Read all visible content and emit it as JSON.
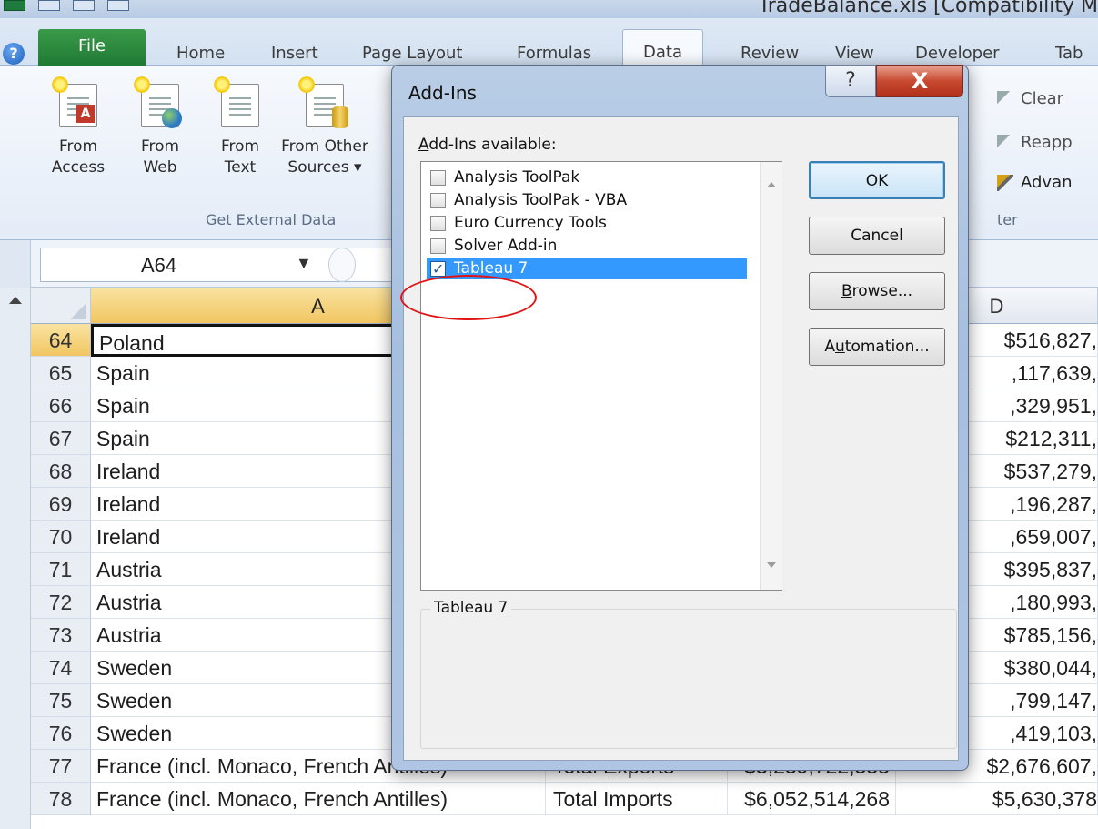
{
  "window": {
    "title": "TradeBalance.xls [Compatibility M"
  },
  "tabs": [
    {
      "label": "File"
    },
    {
      "label": "Home"
    },
    {
      "label": "Insert"
    },
    {
      "label": "Page Layout"
    },
    {
      "label": "Formulas"
    },
    {
      "label": "Data"
    },
    {
      "label": "Review"
    },
    {
      "label": "View"
    },
    {
      "label": "Developer"
    },
    {
      "label": "Tab"
    }
  ],
  "ribbon": {
    "from_access": "From\nAccess",
    "from_web": "From\nWeb",
    "from_text": "From\nText",
    "from_other": "From Other\nSources ▾",
    "group_get_external": "Get External Data",
    "clear": "Clear",
    "reapply": "Reapp",
    "advanced": "Advan",
    "group_filter_tail": "ter"
  },
  "formula_bar": {
    "name_box": "A64"
  },
  "sheet": {
    "columns": {
      "A": "A",
      "D": "D"
    },
    "rows": [
      {
        "n": "64",
        "a": "Poland",
        "b": "",
        "c": "",
        "d": "$516,827,"
      },
      {
        "n": "65",
        "a": "Spain",
        "b": "",
        "c": "",
        "d": ",117,639,"
      },
      {
        "n": "66",
        "a": "Spain",
        "b": "",
        "c": "",
        "d": ",329,951,"
      },
      {
        "n": "67",
        "a": "Spain",
        "b": "",
        "c": "",
        "d": "$212,311,"
      },
      {
        "n": "68",
        "a": "Ireland",
        "b": "",
        "c": "",
        "d": "$537,279,"
      },
      {
        "n": "69",
        "a": "Ireland",
        "b": "",
        "c": "",
        "d": ",196,287,"
      },
      {
        "n": "70",
        "a": "Ireland",
        "b": "",
        "c": "",
        "d": ",659,007,"
      },
      {
        "n": "71",
        "a": "Austria",
        "b": "",
        "c": "",
        "d": "$395,837,"
      },
      {
        "n": "72",
        "a": "Austria",
        "b": "",
        "c": "",
        "d": ",180,993,"
      },
      {
        "n": "73",
        "a": "Austria",
        "b": "",
        "c": "",
        "d": "$785,156,"
      },
      {
        "n": "74",
        "a": "Sweden",
        "b": "",
        "c": "",
        "d": "$380,044,"
      },
      {
        "n": "75",
        "a": "Sweden",
        "b": "",
        "c": "",
        "d": ",799,147,"
      },
      {
        "n": "76",
        "a": "Sweden",
        "b": "",
        "c": "",
        "d": ",419,103,"
      },
      {
        "n": "77",
        "a": "France (incl. Monaco, French Antilles)",
        "b": "Total Exports",
        "c": "$3,239,722,555",
        "d": "$2,676,607,"
      },
      {
        "n": "78",
        "a": "France (incl. Monaco, French Antilles)",
        "b": "Total Imports",
        "c": "$6,052,514,268",
        "d": "$5,630,378"
      }
    ]
  },
  "dialog": {
    "title": "Add-Ins",
    "help": "?",
    "close": "X",
    "available_label_u": "A",
    "available_label_rest": "dd-Ins available:",
    "items": [
      {
        "label": "Analysis ToolPak",
        "checked": false
      },
      {
        "label": "Analysis ToolPak - VBA",
        "checked": false
      },
      {
        "label": "Euro Currency Tools",
        "checked": false
      },
      {
        "label": "Solver Add-in",
        "checked": false
      },
      {
        "label": "Tableau 7",
        "checked": true
      }
    ],
    "ok": "OK",
    "cancel": "Cancel",
    "browse_u": "B",
    "browse_rest": "rowse...",
    "automation_pre": "A",
    "automation_u": "u",
    "automation_rest": "tomation...",
    "description_title": "Tableau 7",
    "description_text": ""
  }
}
